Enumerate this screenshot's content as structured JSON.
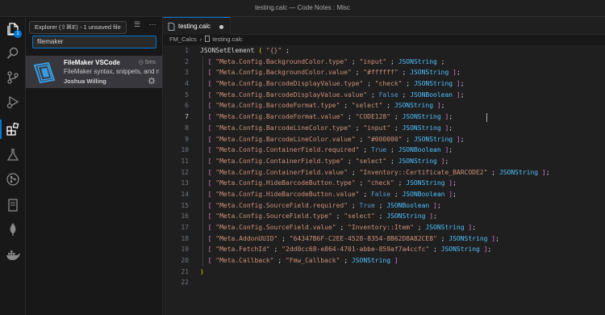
{
  "window": {
    "title": "testing.calc — Code Notes : Misc"
  },
  "activity_bar": {
    "items": [
      {
        "name": "explorer-icon",
        "active": false,
        "badge": "1"
      },
      {
        "name": "search-icon"
      },
      {
        "name": "source-control-icon"
      },
      {
        "name": "run-debug-icon"
      },
      {
        "name": "extensions-icon",
        "active": true
      },
      {
        "name": "testing-icon"
      },
      {
        "name": "git-graph-icon"
      },
      {
        "name": "notebook-icon"
      },
      {
        "name": "mongodb-icon"
      },
      {
        "name": "docker-icon"
      }
    ]
  },
  "sidebar": {
    "tooltip": "Explorer (⇧⌘E) - 1 unsaved file",
    "search_value": "filemaker",
    "extension": {
      "name": "FileMaker VSCode",
      "time": "5ms",
      "description": "FileMaker syntax, snippets, and more",
      "author": "Joshua Willing"
    }
  },
  "editor": {
    "tab_label": "testing.calc",
    "breadcrumb": {
      "folder": "FM_Calcs",
      "file": "testing.calc"
    },
    "line_numbers": [
      "1",
      "2",
      "3",
      "4",
      "5",
      "6",
      "7",
      "8",
      "9",
      "10",
      "11",
      "12",
      "13",
      "14",
      "15",
      "16",
      "17",
      "18",
      "19",
      "20",
      "21",
      "22"
    ],
    "current_line": 7,
    "lines": [
      [
        [
          "kw",
          "JSONSetElement "
        ],
        [
          "br1",
          "( "
        ],
        [
          "str",
          "\"{}\""
        ],
        [
          "kw",
          " ;"
        ]
      ],
      [
        [
          "kw",
          "  "
        ],
        [
          "br2",
          "[ "
        ],
        [
          "str",
          "\"Meta.Config.BackgroundColor.type\""
        ],
        [
          "kw",
          " ; "
        ],
        [
          "str",
          "\"input\""
        ],
        [
          "kw",
          " ; "
        ],
        [
          "type",
          "JSONString"
        ],
        [
          "kw",
          " ;"
        ]
      ],
      [
        [
          "kw",
          "  "
        ],
        [
          "br2",
          "[ "
        ],
        [
          "str",
          "\"Meta.Config.BackgroundColor.value\""
        ],
        [
          "kw",
          " ; "
        ],
        [
          "str",
          "\"#ffffff\""
        ],
        [
          "kw",
          " ; "
        ],
        [
          "type",
          "JSONString"
        ],
        [
          "br2",
          " ]"
        ],
        [
          "kw",
          ";"
        ]
      ],
      [
        [
          "kw",
          "  "
        ],
        [
          "br2",
          "[ "
        ],
        [
          "str",
          "\"Meta.Config.BarcodeDisplayValue.type\""
        ],
        [
          "kw",
          " ; "
        ],
        [
          "str",
          "\"check\""
        ],
        [
          "kw",
          " ; "
        ],
        [
          "type",
          "JSONString"
        ],
        [
          "br2",
          " ]"
        ],
        [
          "kw",
          ";"
        ]
      ],
      [
        [
          "kw",
          "  "
        ],
        [
          "br2",
          "[ "
        ],
        [
          "str",
          "\"Meta.Config.BarcodeDisplayValue.value\""
        ],
        [
          "kw",
          " ; "
        ],
        [
          "bool",
          "False"
        ],
        [
          "kw",
          " ; "
        ],
        [
          "type",
          "JSONBoolean"
        ],
        [
          "br2",
          " ]"
        ],
        [
          "kw",
          ";"
        ]
      ],
      [
        [
          "kw",
          "  "
        ],
        [
          "br2",
          "[ "
        ],
        [
          "str",
          "\"Meta.Config.BarcodeFormat.type\""
        ],
        [
          "kw",
          " ; "
        ],
        [
          "str",
          "\"select\""
        ],
        [
          "kw",
          " ; "
        ],
        [
          "type",
          "JSONString"
        ],
        [
          "br2",
          " ]"
        ],
        [
          "kw",
          ";"
        ]
      ],
      [
        [
          "kw",
          "  "
        ],
        [
          "br2",
          "[ "
        ],
        [
          "str",
          "\"Meta.Config.BarcodeFormat.value\""
        ],
        [
          "kw",
          " ; "
        ],
        [
          "str",
          "\"CODE128\""
        ],
        [
          "kw",
          " ; "
        ],
        [
          "type",
          "JSONString"
        ],
        [
          "br2",
          " ]"
        ],
        [
          "kw",
          ";"
        ]
      ],
      [
        [
          "kw",
          "  "
        ],
        [
          "br2",
          "[ "
        ],
        [
          "str",
          "\"Meta.Config.BarcodeLineColor.type\""
        ],
        [
          "kw",
          " ; "
        ],
        [
          "str",
          "\"input\""
        ],
        [
          "kw",
          " ; "
        ],
        [
          "type",
          "JSONString"
        ],
        [
          "br2",
          " ]"
        ],
        [
          "kw",
          ";"
        ]
      ],
      [
        [
          "kw",
          "  "
        ],
        [
          "br2",
          "[ "
        ],
        [
          "str",
          "\"Meta.Config.BarcodeLineColor.value\""
        ],
        [
          "kw",
          " ; "
        ],
        [
          "str",
          "\"#000000\""
        ],
        [
          "kw",
          " ; "
        ],
        [
          "type",
          "JSONString"
        ],
        [
          "br2",
          " ]"
        ],
        [
          "kw",
          ";"
        ]
      ],
      [
        [
          "kw",
          "  "
        ],
        [
          "br2",
          "[ "
        ],
        [
          "str",
          "\"Meta.Config.ContainerField.required\""
        ],
        [
          "kw",
          " ; "
        ],
        [
          "bool",
          "True"
        ],
        [
          "kw",
          " ; "
        ],
        [
          "type",
          "JSONBoolean"
        ],
        [
          "br2",
          " ]"
        ],
        [
          "kw",
          ";"
        ]
      ],
      [
        [
          "kw",
          "  "
        ],
        [
          "br2",
          "[ "
        ],
        [
          "str",
          "\"Meta.Config.ContainerField.type\""
        ],
        [
          "kw",
          " ; "
        ],
        [
          "str",
          "\"select\""
        ],
        [
          "kw",
          " ; "
        ],
        [
          "type",
          "JSONString"
        ],
        [
          "br2",
          " ]"
        ],
        [
          "kw",
          ";"
        ]
      ],
      [
        [
          "kw",
          "  "
        ],
        [
          "br2",
          "[ "
        ],
        [
          "str",
          "\"Meta.Config.ContainerField.value\""
        ],
        [
          "kw",
          " ; "
        ],
        [
          "str",
          "\"Inventory::Certificate_BARCODE2\""
        ],
        [
          "kw",
          " ; "
        ],
        [
          "type",
          "JSONString"
        ],
        [
          "br2",
          " ]"
        ],
        [
          "kw",
          ";"
        ]
      ],
      [
        [
          "kw",
          "  "
        ],
        [
          "br2",
          "[ "
        ],
        [
          "str",
          "\"Meta.Config.HideBarcodeButton.type\""
        ],
        [
          "kw",
          " ; "
        ],
        [
          "str",
          "\"check\""
        ],
        [
          "kw",
          " ; "
        ],
        [
          "type",
          "JSONString"
        ],
        [
          "br2",
          " ]"
        ],
        [
          "kw",
          ";"
        ]
      ],
      [
        [
          "kw",
          "  "
        ],
        [
          "br2",
          "[ "
        ],
        [
          "str",
          "\"Meta.Config.HideBarcodeButton.value\""
        ],
        [
          "kw",
          " ; "
        ],
        [
          "bool",
          "False"
        ],
        [
          "kw",
          " ; "
        ],
        [
          "type",
          "JSONBoolean"
        ],
        [
          "br2",
          " ]"
        ],
        [
          "kw",
          ";"
        ]
      ],
      [
        [
          "kw",
          "  "
        ],
        [
          "br2",
          "[ "
        ],
        [
          "str",
          "\"Meta.Config.SourceField.required\""
        ],
        [
          "kw",
          " ; "
        ],
        [
          "bool",
          "True"
        ],
        [
          "kw",
          " ; "
        ],
        [
          "type",
          "JSONBoolean"
        ],
        [
          "br2",
          " ]"
        ],
        [
          "kw",
          ";"
        ]
      ],
      [
        [
          "kw",
          "  "
        ],
        [
          "br2",
          "[ "
        ],
        [
          "str",
          "\"Meta.Config.SourceField.type\""
        ],
        [
          "kw",
          " ; "
        ],
        [
          "str",
          "\"select\""
        ],
        [
          "kw",
          " ; "
        ],
        [
          "type",
          "JSONString"
        ],
        [
          "br2",
          " ]"
        ],
        [
          "kw",
          ";"
        ]
      ],
      [
        [
          "kw",
          "  "
        ],
        [
          "br2",
          "[ "
        ],
        [
          "str",
          "\"Meta.Config.SourceField.value\""
        ],
        [
          "kw",
          " ; "
        ],
        [
          "str",
          "\"Inventory::Item\""
        ],
        [
          "kw",
          " ; "
        ],
        [
          "type",
          "JSONString"
        ],
        [
          "br2",
          " ]"
        ],
        [
          "kw",
          ";"
        ]
      ],
      [
        [
          "kw",
          "  "
        ],
        [
          "br2",
          "[ "
        ],
        [
          "str",
          "\"Meta.AddonUUID\""
        ],
        [
          "kw",
          " ; "
        ],
        [
          "str",
          "\"64347B6F-C2EE-4528-8354-8B62D8A82CE8\""
        ],
        [
          "kw",
          " ; "
        ],
        [
          "type",
          "JSONString"
        ],
        [
          "br2",
          " ]"
        ],
        [
          "kw",
          ";"
        ]
      ],
      [
        [
          "kw",
          "  "
        ],
        [
          "br2",
          "[ "
        ],
        [
          "str",
          "\"Meta.FetchId\""
        ],
        [
          "kw",
          " ; "
        ],
        [
          "str",
          "\"2dd0cc68-e864-4701-abbe-859af7a4ccfc\""
        ],
        [
          "kw",
          " ; "
        ],
        [
          "type",
          "JSONString"
        ],
        [
          "br2",
          " ]"
        ],
        [
          "kw",
          ";"
        ]
      ],
      [
        [
          "kw",
          "  "
        ],
        [
          "br2",
          "[ "
        ],
        [
          "str",
          "\"Meta.Callback\""
        ],
        [
          "kw",
          " ; "
        ],
        [
          "str",
          "\"Fmw_Callback\""
        ],
        [
          "kw",
          " ; "
        ],
        [
          "type",
          "JSONString"
        ],
        [
          "br2",
          " ]"
        ]
      ],
      [
        [
          "br1",
          ")"
        ]
      ],
      []
    ]
  },
  "colors": {
    "accent": "#0078d4",
    "string": "#ce9178",
    "type": "#4fc1ff",
    "boolean": "#569cd6",
    "bracket_outer": "#ffd700",
    "bracket_inner": "#da70d6"
  }
}
